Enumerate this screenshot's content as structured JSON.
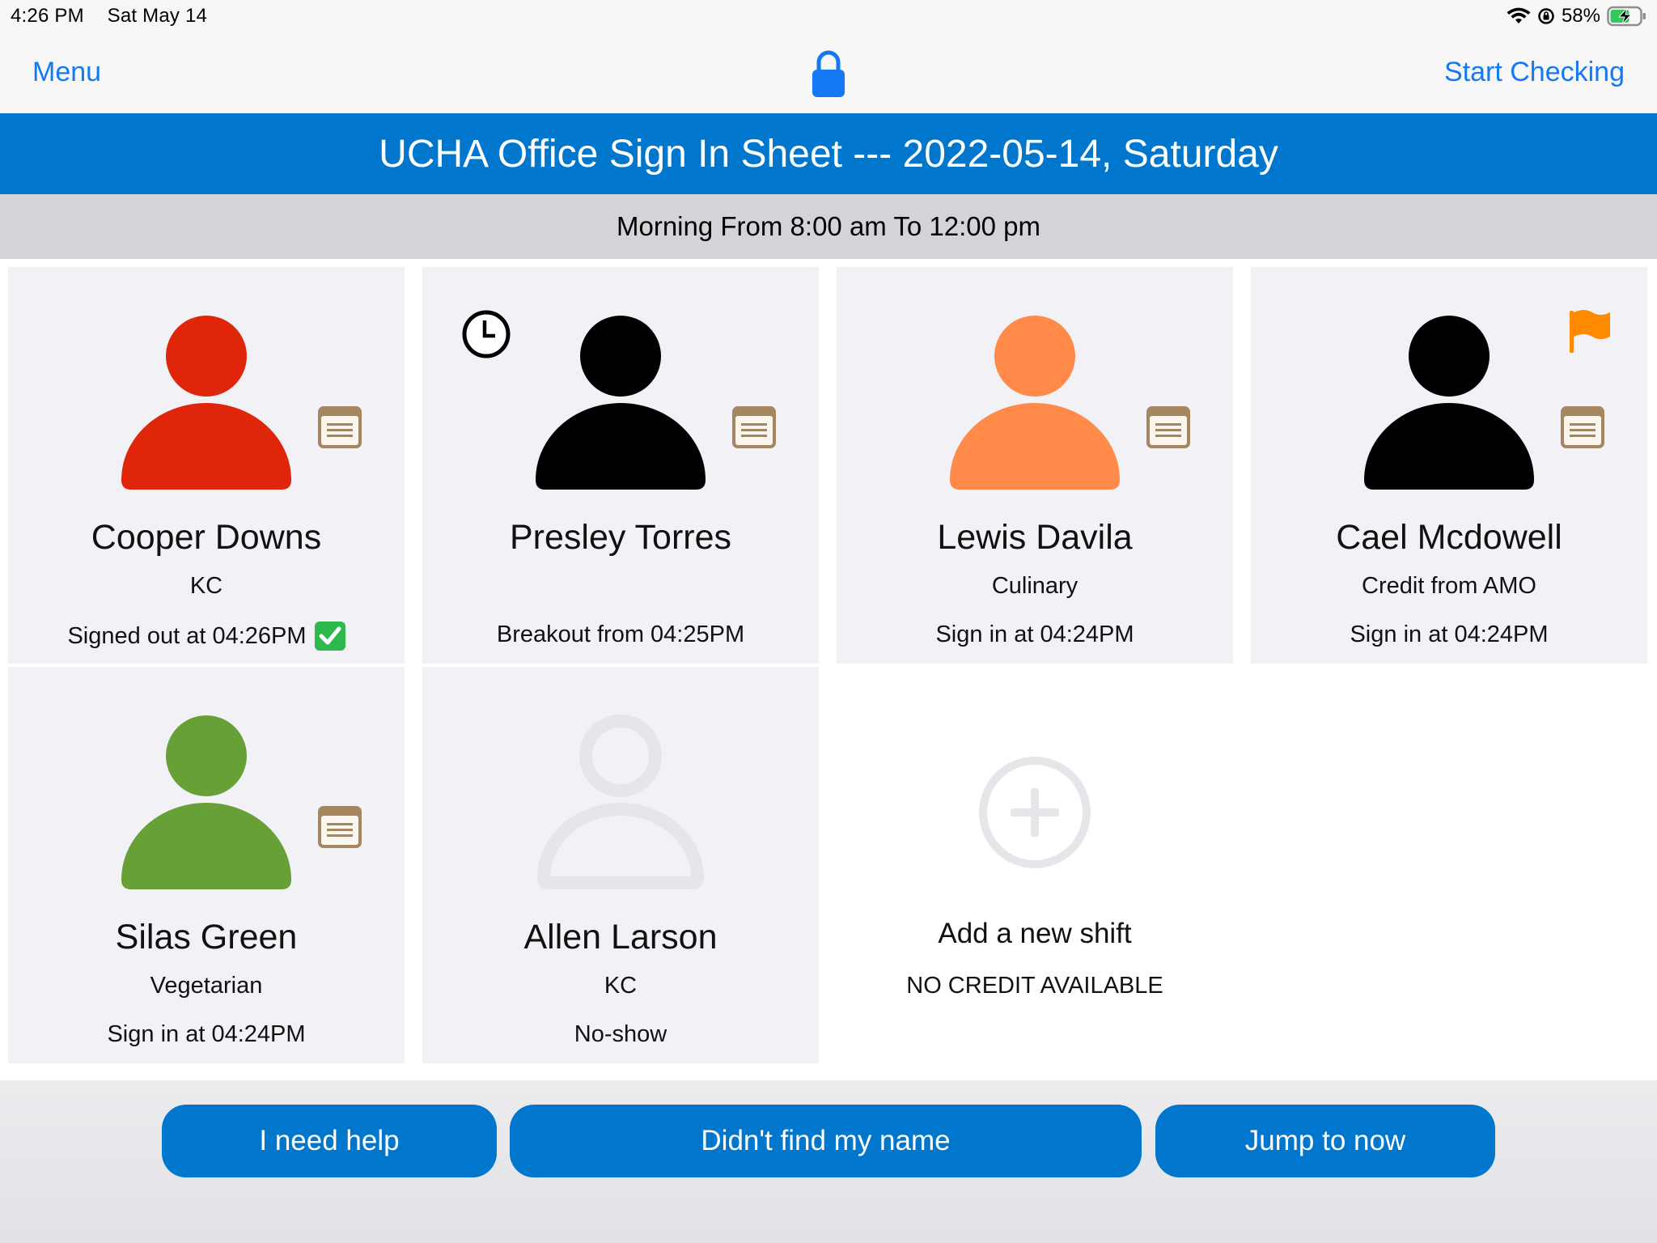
{
  "status_bar": {
    "time": "4:26 PM",
    "date": "Sat May 14",
    "battery": "58%",
    "icons": [
      "wifi-icon",
      "orientation-lock-icon",
      "battery-charging-icon"
    ]
  },
  "nav": {
    "menu_label": "Menu",
    "start_label": "Start Checking",
    "lock_icon": "lock-icon"
  },
  "title": "UCHA Office Sign In Sheet --- 2022-05-14, Saturday",
  "session": "Morning From 8:00 am To 12:00 pm",
  "colors": {
    "accent_blue": "#0077cc",
    "link_blue": "#1479f2",
    "red": "#e0260a",
    "black": "#000000",
    "orange": "#ff8a4a",
    "green": "#67a036",
    "placeholder": "#e5e5ea",
    "flag": "#ff8a00"
  },
  "shifts": [
    {
      "name": "Cooper Downs",
      "subtitle": "KC",
      "status": "Signed out at 04:26PM",
      "status_icon": "checkmark-icon",
      "avatar_color": "#e0260a",
      "badges": [
        "note-icon"
      ]
    },
    {
      "name": "Presley Torres",
      "subtitle": "",
      "status": "Breakout from 04:25PM",
      "avatar_color": "#000000",
      "badges": [
        "clock-icon",
        "note-icon"
      ]
    },
    {
      "name": "Lewis Davila",
      "subtitle": "Culinary",
      "status": "Sign in at 04:24PM",
      "avatar_color": "#ff8a4a",
      "badges": [
        "note-icon"
      ]
    },
    {
      "name": "Cael Mcdowell",
      "subtitle": "Credit from AMO",
      "status": "Sign in at 04:24PM",
      "avatar_color": "#000000",
      "badges": [
        "flag-icon",
        "note-icon"
      ]
    },
    {
      "name": "Silas Green",
      "subtitle": "Vegetarian",
      "status": "Sign in at 04:24PM",
      "avatar_color": "#67a036",
      "badges": [
        "note-icon"
      ]
    },
    {
      "name": "Allen Larson",
      "subtitle": "KC",
      "status": "No-show",
      "avatar_color": "#e5e5ea",
      "badges": []
    }
  ],
  "add_shift": {
    "label": "Add a new shift",
    "credit": "NO CREDIT AVAILABLE"
  },
  "buttons": {
    "help": "I need help",
    "not_found": "Didn't find my name",
    "jump": "Jump to now"
  }
}
